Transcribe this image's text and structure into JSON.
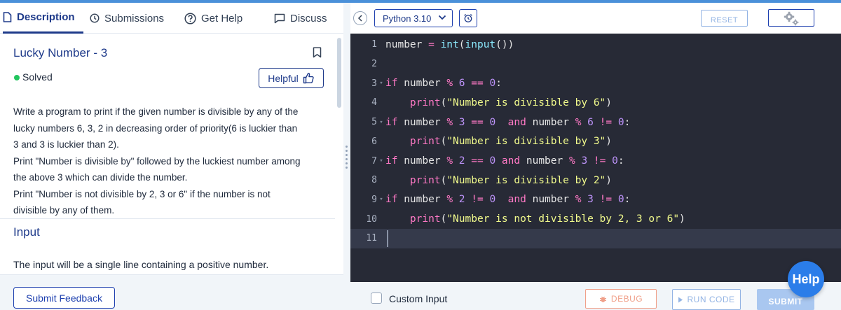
{
  "tabs": {
    "description": "Description",
    "submissions": "Submissions",
    "get_help": "Get Help",
    "discuss": "Discuss"
  },
  "problem": {
    "title": "Lucky Number - 3",
    "status": "Solved",
    "helpful_label": "Helpful",
    "description_lines": [
      "Write a program to print if the given number is divisible by any of the",
      "lucky numbers 6, 3, 2 in decreasing order of priority(6 is luckier than",
      "3 and 3 is luckier than 2).",
      "Print \"Number is divisible by\" followed by the luckiest number among",
      "the above 3 which can divide the number.",
      "Print \"Number is not divisible by 2, 3 or 6\" if the number is not",
      "divisible by any of them."
    ],
    "input_heading": "Input",
    "input_text": "The input will be a single line containing a positive number."
  },
  "feedback_button": "Submit Feedback",
  "editor": {
    "language": "Python 3.10",
    "reset_label": "RESET",
    "line_numbers": [
      "1",
      "2",
      "3",
      "4",
      "5",
      "6",
      "7",
      "8",
      "9",
      "10",
      "11"
    ],
    "code_lines": [
      "number = int(input())",
      "",
      "if number % 6 == 0:",
      "    print(\"Number is divisible by 6\")",
      "if number % 3 == 0  and number % 6 != 0:",
      "    print(\"Number is divisible by 3\")",
      "if number % 2 == 0 and number % 3 != 0:",
      "    print(\"Number is divisible by 2\")",
      "if number % 2 != 0  and number % 3 != 0:",
      "    print(\"Number is not divisible by 2, 3 or 6\")",
      ""
    ],
    "current_line": 11
  },
  "footer": {
    "custom_input_label": "Custom Input",
    "debug_label": "DEBUG",
    "run_label": "RUN CODE",
    "submit_label": "SUBMIT"
  },
  "help_fab": "Help",
  "colors": {
    "accent": "#1e3a8a",
    "editor_bg": "#272a36",
    "solved": "#22c55e",
    "help_fab": "#2b7de9"
  }
}
